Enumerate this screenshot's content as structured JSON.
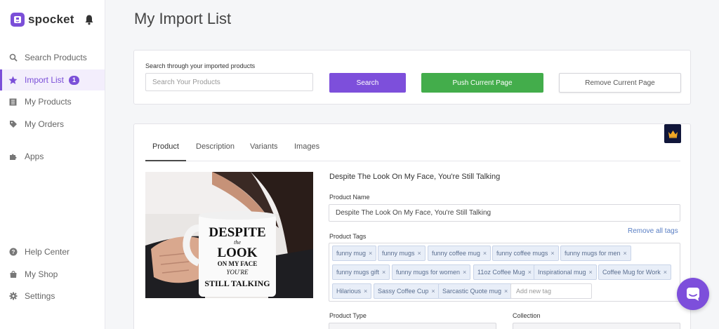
{
  "brand": {
    "name": "spocket"
  },
  "sidebar": {
    "items": [
      {
        "label": "Search Products",
        "icon": "search-icon"
      },
      {
        "label": "Import List",
        "icon": "star-icon",
        "badge": "1",
        "active": true
      },
      {
        "label": "My Products",
        "icon": "list-icon"
      },
      {
        "label": "My Orders",
        "icon": "tag-icon"
      },
      {
        "label": "Apps",
        "icon": "puzzle-icon"
      },
      {
        "label": "Help Center",
        "icon": "help-icon"
      },
      {
        "label": "My Shop",
        "icon": "shop-icon"
      },
      {
        "label": "Settings",
        "icon": "gear-icon"
      }
    ]
  },
  "page": {
    "title": "My Import List"
  },
  "search": {
    "label": "Search through your imported products",
    "placeholder": "Search Your Products",
    "search_button": "Search",
    "push_button": "Push Current Page",
    "remove_button": "Remove Current Page"
  },
  "product": {
    "tabs": [
      "Product",
      "Description",
      "Variants",
      "Images"
    ],
    "active_tab": "Product",
    "heading": "Despite The Look On My Face, You're Still Talking",
    "name_label": "Product Name",
    "name_value": "Despite The Look On My Face, You're Still Talking",
    "tags_label": "Product Tags",
    "remove_all_tags": "Remove all tags",
    "tags": [
      "funny mug",
      "funny mugs",
      "funny coffee mug",
      "funny coffee mugs",
      "funny mugs for men",
      "funny mugs gift",
      "funny mugs for women",
      "11oz Coffee Mug",
      "Inspirational mug",
      "Coffee Mug for Work",
      "Hilarious",
      "Sassy Coffee Cup",
      "Sarcastic Quote mug"
    ],
    "tag_remove_symbol": "×",
    "new_tag_placeholder": "Add new tag",
    "type_label": "Product Type",
    "collection_label": "Collection",
    "image_text": [
      "DESPITE",
      "the",
      "LOOK",
      "ON MY FACE",
      "YOU'RE",
      "STILL TALKING"
    ]
  },
  "colors": {
    "accent": "#7d4fdb",
    "push": "#43ad4b",
    "tag_bg": "#e8eef8"
  }
}
